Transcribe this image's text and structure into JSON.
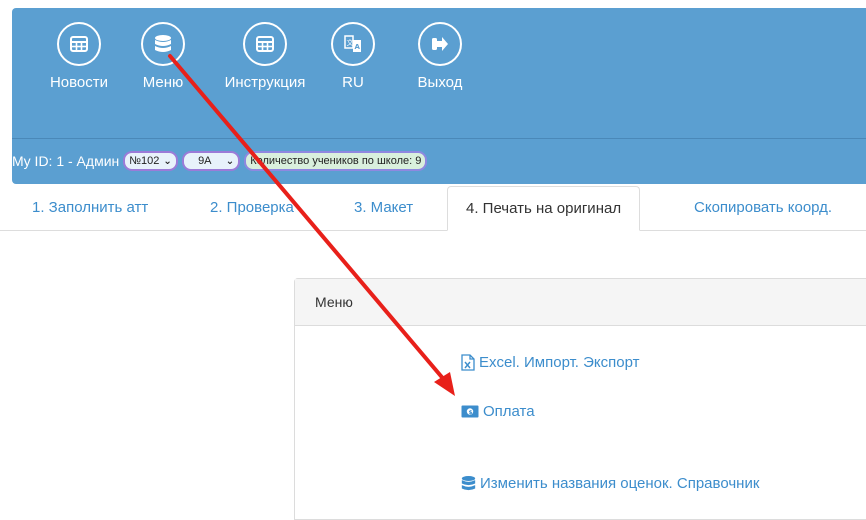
{
  "nav": [
    {
      "label": "Новости",
      "icon": "table-icon"
    },
    {
      "label": "Меню",
      "icon": "database-icon"
    },
    {
      "label": "Инструкция",
      "icon": "table-icon"
    },
    {
      "label": "RU",
      "icon": "language-icon"
    },
    {
      "label": "Выход",
      "icon": "logout-icon"
    }
  ],
  "status_bar": {
    "my_id": "My ID: 1 - Админ",
    "school_select": "№102",
    "class_select": "9А",
    "student_count": "Количество учеников по школе: 9"
  },
  "tabs": [
    {
      "label": "1. Заполнить атт"
    },
    {
      "label": "2. Проверка"
    },
    {
      "label": "3. Макет"
    },
    {
      "label": "4. Печать на оригинал",
      "active": true
    },
    {
      "label": "Скопировать коорд."
    }
  ],
  "panel": {
    "title": "Меню",
    "items": [
      {
        "label": "Excel. Импорт. Экспорт",
        "icon": "excel-file-icon"
      },
      {
        "label": "Оплата",
        "icon": "money-icon"
      },
      {
        "label": "Изменить названия оценок. Справочник",
        "icon": "database-icon"
      }
    ]
  },
  "colors": {
    "header_bg": "#5b9fd1",
    "link": "#3c8dcc",
    "annotation_arrow": "#e8201a"
  }
}
